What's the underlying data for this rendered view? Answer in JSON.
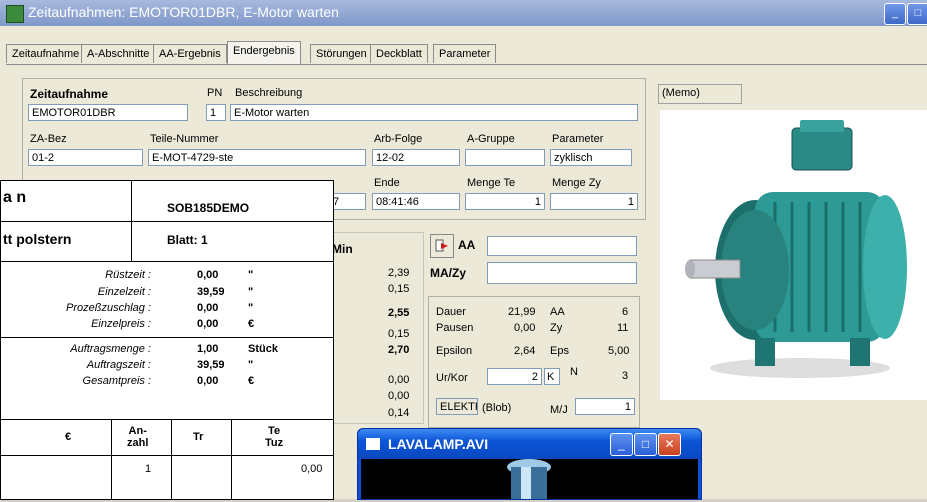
{
  "window": {
    "title": "Zeitaufnahmen: EMOTOR01DBR, E-Motor warten"
  },
  "tabs": [
    "Zeitaufnahme",
    "A-Abschnitte",
    "AA-Ergebnis",
    "Endergebnis",
    "Störungen",
    "Deckblatt",
    "Parameter"
  ],
  "active_tab": "Endergebnis",
  "header": {
    "zeitaufnahme_label": "Zeitaufnahme",
    "zeitaufnahme_value": "EMOTOR01DBR",
    "pn_label": "PN",
    "pn_value": "1",
    "beschreibung_label": "Beschreibung",
    "beschreibung_value": "E-Motor warten",
    "zabez_label": "ZA-Bez",
    "zabez_value": "01-2",
    "teile_label": "Teile-Nummer",
    "teile_value": "E-MOT-4729-ste",
    "arbfolge_label": "Arb-Folge",
    "arbfolge_value": "12-02",
    "agruppe_label": "A-Gruppe",
    "agruppe_value": "",
    "parameter_label": "Parameter",
    "parameter_value": "zyklisch",
    "ende_label": "Ende",
    "ende_value": "08:41:46",
    "menge_te_label": "Menge Te",
    "menge_te_value": "1",
    "menge_zy_label": "Menge Zy",
    "menge_zy_value": "1",
    "partial_left_value": "7"
  },
  "memo_label": "(Memo)",
  "min_label": "Min",
  "min_values": [
    "2,39",
    "0,15",
    "2,55",
    "0,15",
    "2,70",
    "0,00",
    "0,00",
    "0,14"
  ],
  "aa_label": "AA",
  "aa_value": "",
  "mazy_label": "MA/Zy",
  "mazy_value": "",
  "stats": {
    "dauer_label": "Dauer",
    "dauer_value": "21,99",
    "dauer_unit": "AA",
    "dauer_count": "6",
    "pausen_label": "Pausen",
    "pausen_value": "0,00",
    "pausen_unit": "Zy",
    "pausen_count": "11",
    "epsilon_label": "Epsilon",
    "epsilon_value": "2,64",
    "epsilon_unit": "Eps",
    "epsilon_count": "5,00",
    "urkor_label": "Ur/Kor",
    "urkor_value": "2",
    "urkor_k": "K",
    "urkor_n": "N",
    "urkor_count": "3",
    "blob_field": "ELEKTRI",
    "blob_label": "(Blob)",
    "mj_label": "M/J",
    "mj_value": "1"
  },
  "report": {
    "title_partial": "a n",
    "subtitle_partial": "tt polstern",
    "code": "SOB185DEMO",
    "blatt": "Blatt:  1",
    "rows": [
      {
        "label": "Rüstzeit :",
        "value": "0,00",
        "unit": "\""
      },
      {
        "label": "Einzelzeit :",
        "value": "39,59",
        "unit": "\""
      },
      {
        "label": "Prozeßzuschlag :",
        "value": "0,00",
        "unit": "\""
      },
      {
        "label": "Einzelpreis :",
        "value": "0,00",
        "unit": "€"
      },
      {
        "label": "Auftragsmenge :",
        "value": "1,00",
        "unit": "Stück"
      },
      {
        "label": "Auftragszeit :",
        "value": "39,59",
        "unit": "\""
      },
      {
        "label": "Gesamtpreis :",
        "value": "0,00",
        "unit": "€"
      }
    ],
    "table_headers": [
      "€",
      "An-\nzahl",
      "Tr",
      "Te\nTuz"
    ],
    "table_row": [
      "",
      "1",
      "",
      "0,00"
    ]
  },
  "video": {
    "title": "LAVALAMP.AVI"
  }
}
